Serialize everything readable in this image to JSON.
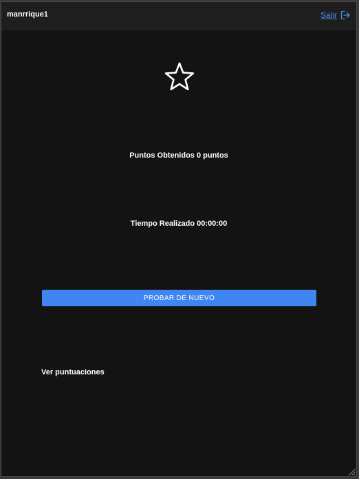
{
  "header": {
    "username": "manrrique1",
    "logout_label": "Salir",
    "logout_icon": "logout-icon",
    "accent_color": "#3f86f2"
  },
  "result": {
    "icon": "star-icon",
    "points_text": "Puntos Obtenidos 0 puntos",
    "time_text": "Tiempo Realizado 00:00:00"
  },
  "actions": {
    "retry_label": "PROBAR DE NUEVO",
    "scores_link": "Ver puntuaciones"
  }
}
